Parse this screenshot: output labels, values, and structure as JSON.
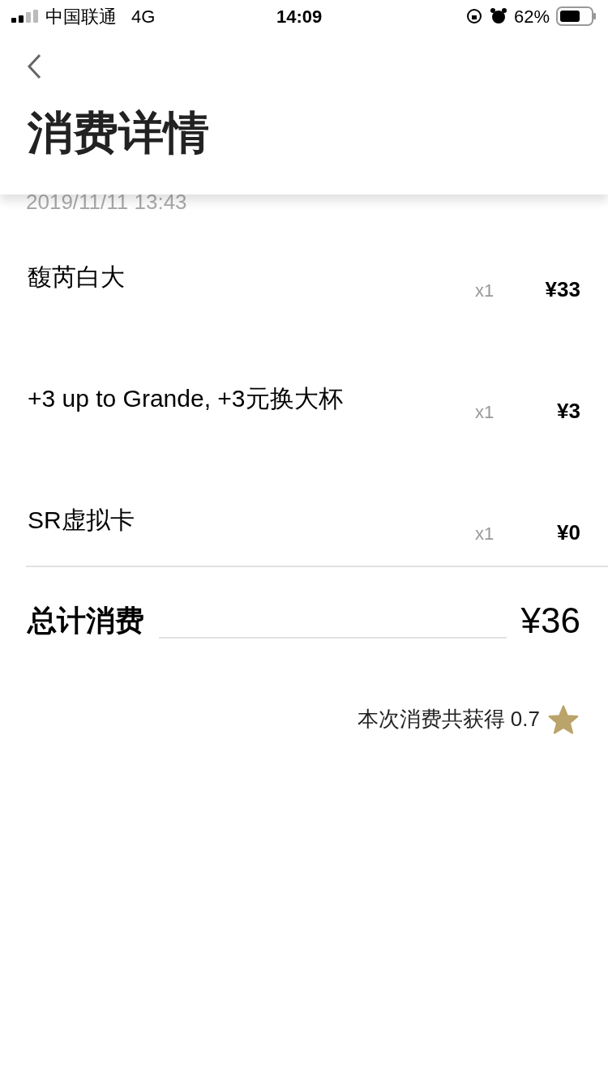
{
  "status_bar": {
    "carrier": "中国联通",
    "network": "4G",
    "time": "14:09",
    "battery": "62%"
  },
  "header": {
    "title": "消费详情"
  },
  "date": "2019/11/11 13:43",
  "items": [
    {
      "name": "馥芮白大",
      "qty": "x1",
      "price": "¥33"
    },
    {
      "name": "+3 up to Grande, +3元换大杯",
      "qty": "x1",
      "price": "¥3"
    },
    {
      "name": "SR虚拟卡",
      "qty": "x1",
      "price": "¥0"
    }
  ],
  "total": {
    "label": "总计消费",
    "amount": "¥36"
  },
  "reward": {
    "text": "本次消费共获得 0.7"
  }
}
